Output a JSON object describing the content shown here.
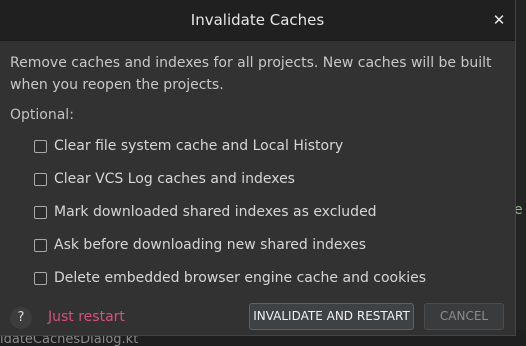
{
  "dialog": {
    "title": "Invalidate Caches",
    "close_glyph": "✕",
    "description": "Remove caches and indexes for all projects. New caches will be built when you reopen the projects.",
    "optional_label": "Optional:",
    "options": [
      {
        "label": "Clear file system cache and Local History",
        "checked": false
      },
      {
        "label": "Clear VCS Log caches and indexes",
        "checked": false
      },
      {
        "label": "Mark downloaded shared indexes as excluded",
        "checked": false
      },
      {
        "label": "Ask before downloading new shared indexes",
        "checked": false
      },
      {
        "label": "Delete embedded browser engine cache and cookies",
        "checked": false
      }
    ],
    "help_glyph": "?",
    "just_restart_label": "Just restart",
    "invalidate_button_label": "INVALIDATE AND RESTART",
    "cancel_button_label": "CANCEL"
  },
  "background": {
    "bottom_text": "idateCachesDialog.kt",
    "edge_text": "e"
  },
  "colors": {
    "dialog_bg": "#323232",
    "titlebar_bg": "#202020",
    "link_pink": "#d9507a"
  }
}
